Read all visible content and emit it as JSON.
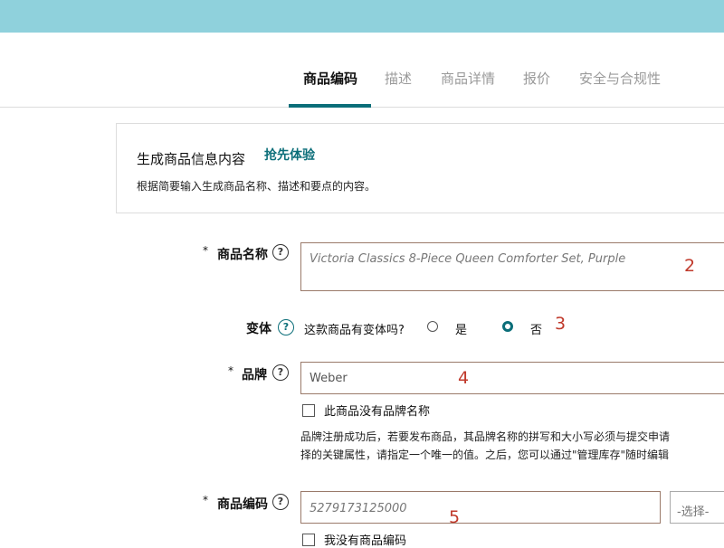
{
  "tabs": [
    {
      "label": "商品编码",
      "active": true
    },
    {
      "label": "描述"
    },
    {
      "label": "商品详情"
    },
    {
      "label": "报价"
    },
    {
      "label": "安全与合规性"
    }
  ],
  "info_box": {
    "title": "生成商品信息内容",
    "link": "抢先体验",
    "description": "根据简要输入生成商品名称、描述和要点的内容。"
  },
  "product_name": {
    "required_mark": "*",
    "label": "商品名称",
    "value": "Victoria Classics 8-Piece Queen Comforter Set, Purple",
    "annotation": "2"
  },
  "variant": {
    "label": "变体",
    "question": "这款商品有变体吗?",
    "option_yes": "是",
    "option_no": "否",
    "selected": "否",
    "annotation": "3"
  },
  "brand": {
    "required_mark": "*",
    "label": "品牌",
    "value": "Weber",
    "annotation": "4",
    "no_brand_label": "此商品没有品牌名称",
    "note_line1": "品牌注册成功后，若要发布商品，其品牌名称的拼写和大小写必须与提交申请",
    "note_line2": "择的关键属性，请指定一个唯一的值。之后，您可以通过\"管理库存\"随时编辑"
  },
  "product_code": {
    "required_mark": "*",
    "label": "商品编码",
    "value": "5279173125000",
    "annotation": "5",
    "select_placeholder": "-选择-",
    "no_code_label": "我没有商品编码"
  },
  "colors": {
    "accent": "#0b6e79",
    "topbar": "#8fd1dc",
    "annotation": "#c0392b"
  }
}
